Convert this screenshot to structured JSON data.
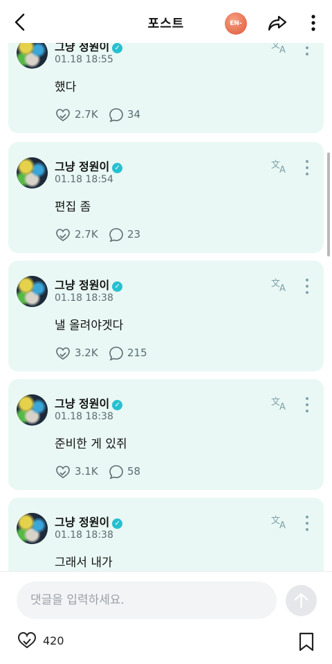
{
  "header": {
    "title": "포스트",
    "badge": "EN-",
    "back_icon": "chevron-left-icon",
    "share_icon": "share-icon",
    "more_icon": "more-vertical-icon"
  },
  "posts": [
    {
      "author": "그냥 정원이",
      "date": "01.18 18:55",
      "text": "했다",
      "likes": "2.7K",
      "comments": "34"
    },
    {
      "author": "그냥 정원이",
      "date": "01.18 18:54",
      "text": "편집 좀",
      "likes": "2.7K",
      "comments": "23"
    },
    {
      "author": "그냥 정원이",
      "date": "01.18 18:38",
      "text": "낼 올려야겟다",
      "likes": "3.2K",
      "comments": "215"
    },
    {
      "author": "그냥 정원이",
      "date": "01.18 18:38",
      "text": "준비한 게 있쥐",
      "likes": "3.1K",
      "comments": "58"
    },
    {
      "author": "그냥 정원이",
      "date": "01.18 18:38",
      "text": "그래서 내가",
      "likes": "",
      "comments": ""
    }
  ],
  "footer": {
    "comment_placeholder": "댓글을 입력하세요.",
    "like_count": "420"
  },
  "colors": {
    "card_bg": "#e9f8f4",
    "verified": "#27c0d0",
    "badge": "#e76c4f",
    "muted_text": "#5a6b72"
  }
}
